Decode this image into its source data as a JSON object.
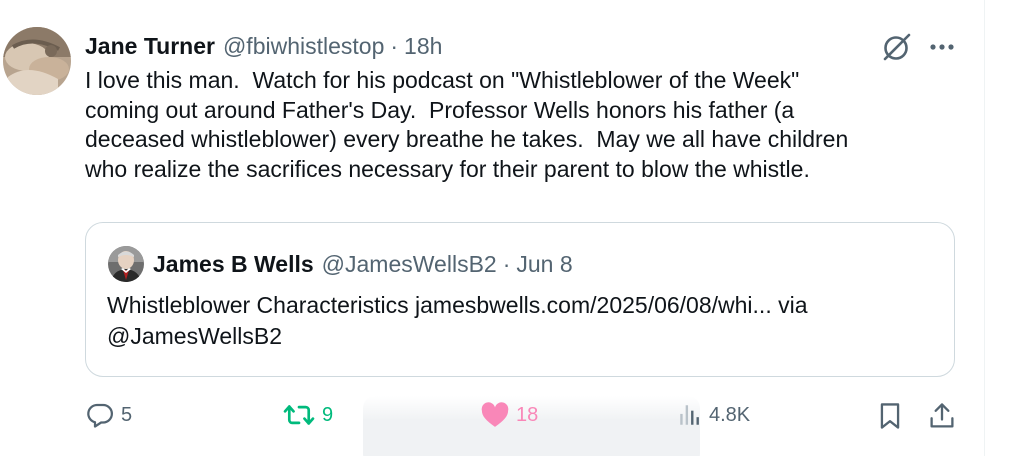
{
  "tweet": {
    "author_name": "Jane Turner",
    "author_handle": "@fbiwhistlestop",
    "separator": "·",
    "time": "18h",
    "text": "I love this man.  Watch for his podcast on \"Whistleblower of the Week\"\ncoming out around Father's Day.  Professor Wells honors his father (a\ndeceased whistleblower) every breathe he takes.  May we all have children\nwho realize the sacrifices necessary for their parent to blow the whistle."
  },
  "quote": {
    "author_name": "James B Wells",
    "author_handle": "@JamesWellsB2",
    "separator": "·",
    "date": "Jun 8",
    "text": "Whistleblower Characteristics jamesbwells.com/2025/06/08/whi... via @JamesWellsB2"
  },
  "actions": {
    "replies": "5",
    "reposts": "9",
    "likes": "18",
    "views": "4.8K"
  },
  "icons": {
    "grok": "grok-icon",
    "more": "more-icon",
    "reply": "reply-icon",
    "repost": "repost-icon",
    "like": "heart-icon",
    "views": "views-icon",
    "bookmark": "bookmark-icon",
    "share": "share-icon"
  },
  "colors": {
    "text": "#0f1419",
    "muted": "#536471",
    "repost_active": "#00ba7c",
    "like_active": "#f91880",
    "border": "#cfd9de"
  }
}
